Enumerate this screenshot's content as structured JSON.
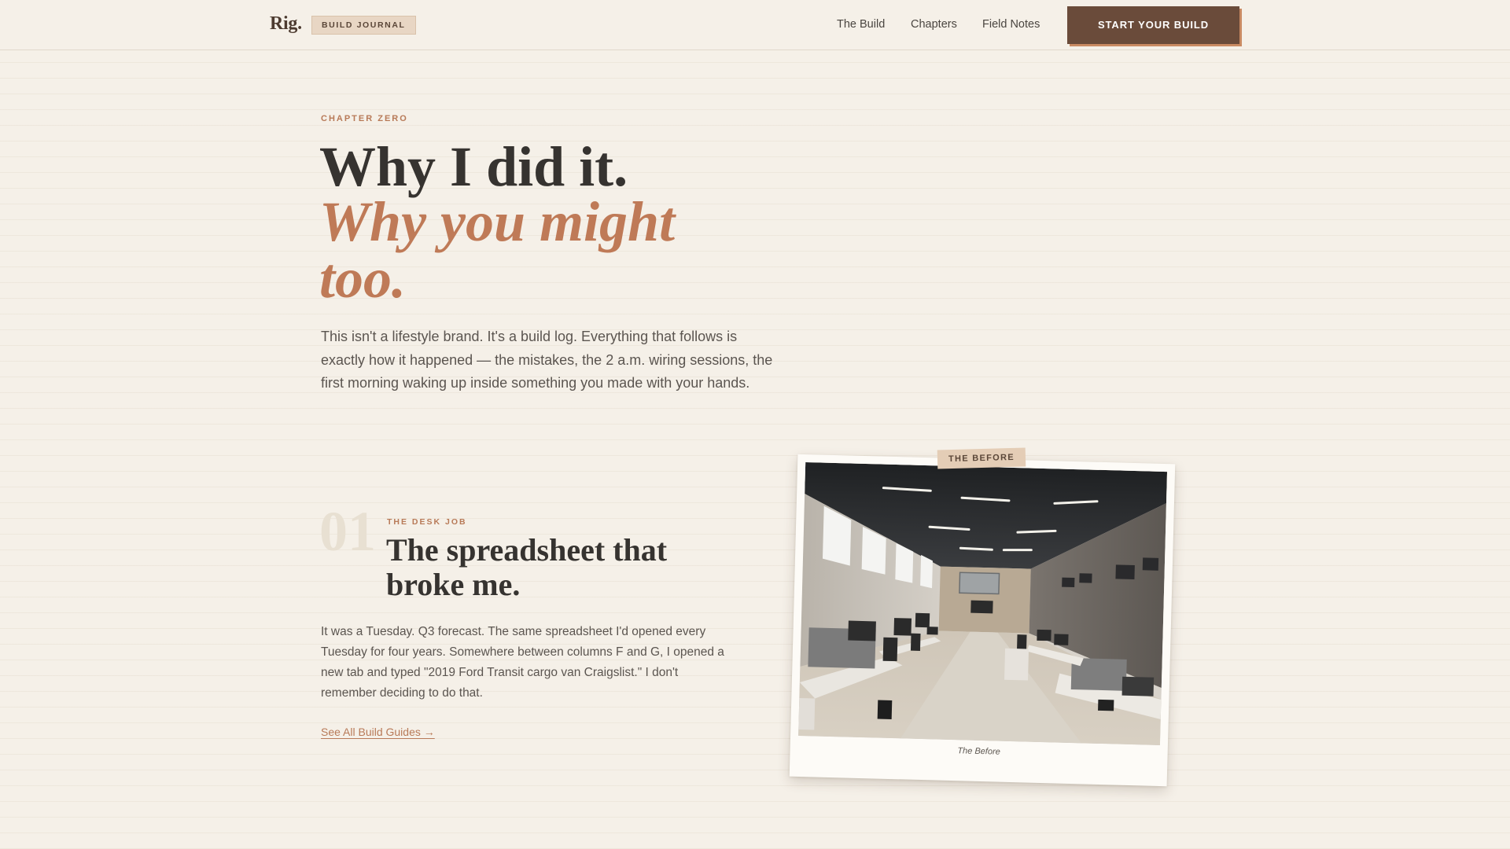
{
  "header": {
    "logo": "Rig.",
    "badge": "BUILD JOURNAL",
    "nav": [
      "The Build",
      "Chapters",
      "Field Notes"
    ],
    "cta": "START YOUR BUILD"
  },
  "hero": {
    "eyebrow": "CHAPTER ZERO",
    "title_line1": "Why I did it.",
    "title_line2": "Why you might too.",
    "lede": "This isn't a lifestyle brand. It's a build log. Everything that follows is exactly how it happened — the mistakes, the 2 a.m. wiring sessions, the first morning waking up inside something you made with your hands."
  },
  "section": {
    "number": "01",
    "eyebrow": "THE DESK JOB",
    "title": "The spreadsheet that broke me.",
    "body": "It was a Tuesday. Q3 forecast. The same spreadsheet I'd opened every Tuesday for four years. Somewhere between columns F and G, I opened a new tab and typed \"2019 Ford Transit cargo van Craigslist.\" I don't remember deciding to do that.",
    "link": "See All Build Guides →"
  },
  "photo": {
    "tape_label": "THE BEFORE",
    "caption": "The Before",
    "alt": "Open-plan office with rows of desks"
  },
  "colors": {
    "background": "#f5f0e8",
    "accent": "#bf7a57",
    "cta": "#6a4b3a",
    "ink": "#363330"
  }
}
